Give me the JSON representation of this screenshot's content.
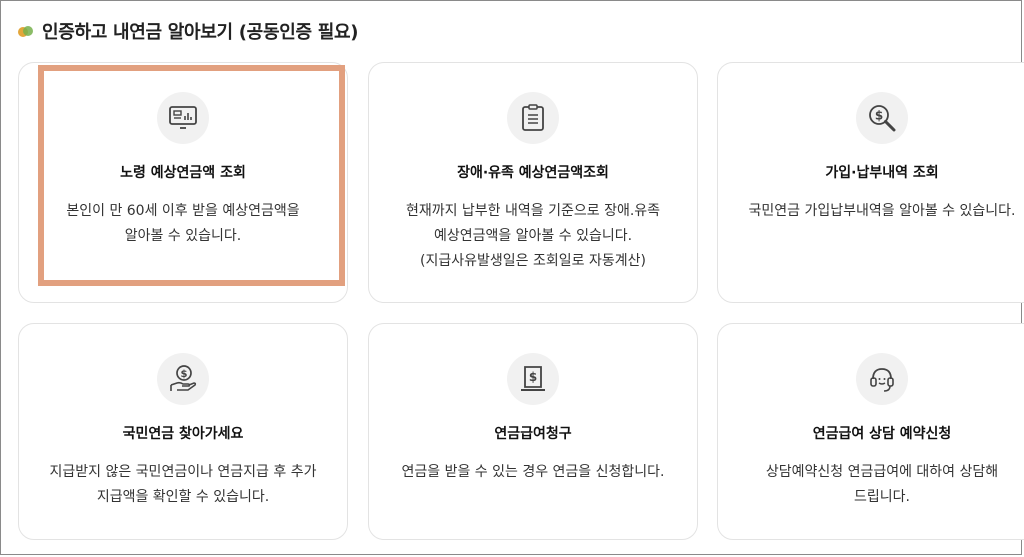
{
  "header": {
    "title": "인증하고 내연금 알아보기 (공동인증 필요)"
  },
  "cards": [
    {
      "title": "노령 예상연금액 조회",
      "desc": [
        "본인이 만 60세 이후 받을 예상연금액을",
        "알아볼 수 있습니다."
      ],
      "icon": "monitor-chart-icon"
    },
    {
      "title": "장애·유족 예상연금액조회",
      "desc": [
        "현재까지 납부한 내역을 기준으로 장애.유족",
        "예상연금액을 알아볼 수 있습니다.",
        "(지급사유발생일은 조회일로 자동계산)"
      ],
      "icon": "clipboard-icon"
    },
    {
      "title": "가입·납부내역 조회",
      "desc": [
        "국민연금 가입납부내역을 알아볼 수 있습니다."
      ],
      "icon": "dollar-search-icon"
    },
    {
      "title": "국민연금 찾아가세요",
      "desc": [
        "지급받지 않은 국민연금이나 연금지급 후 추가",
        "지급액을 확인할 수 있습니다."
      ],
      "icon": "hand-coin-icon"
    },
    {
      "title": "연금급여청구",
      "desc": [
        "연금을 받을 수 있는 경우 연금을 신청합니다."
      ],
      "icon": "document-dollar-icon"
    },
    {
      "title": "연금급여 상담 예약신청",
      "desc": [
        "상담예약신청 연금급여에 대하여 상담해",
        "드립니다."
      ],
      "icon": "headset-icon"
    }
  ],
  "colors": {
    "highlight": "#e2a07f",
    "icon_bg": "#f1f1f1",
    "card_border": "#e3e3e3"
  }
}
